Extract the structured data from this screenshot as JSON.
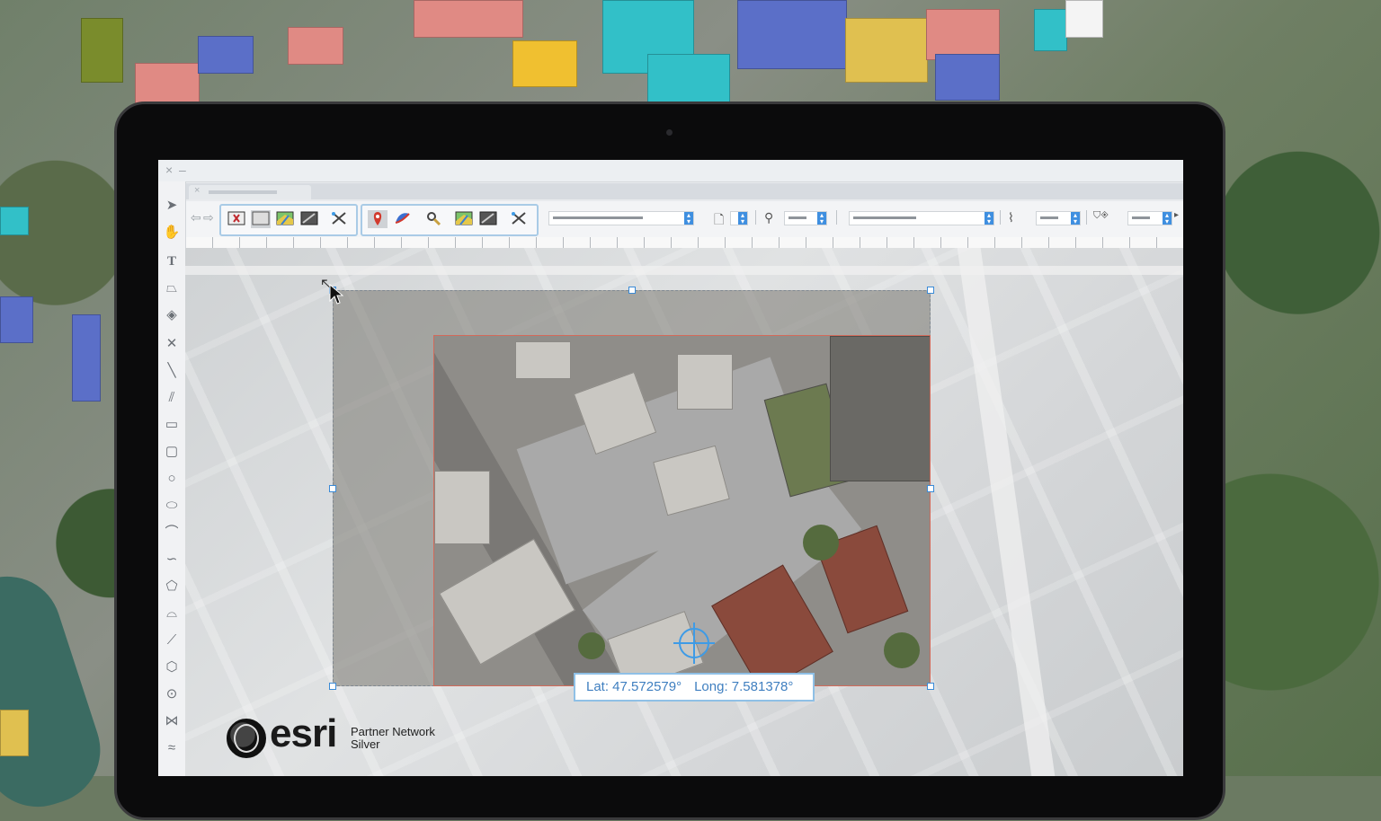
{
  "window": {
    "close_glyph": "×",
    "minimize_glyph": "–",
    "tab_close_glyph": "×"
  },
  "toolbar": {
    "nav_back": "⇦",
    "nav_forward": "⇨",
    "group1": [
      "delete-layer-icon",
      "blank-map-icon",
      "color-map-icon",
      "dark-map-icon",
      "tools-icon"
    ],
    "group2": [
      "map-pin-icon",
      "compass-icon",
      "zoom-tool-icon",
      "color-map-icon",
      "dark-map-icon",
      "tools-icon"
    ]
  },
  "left_tools": [
    "select-arrow-icon",
    "pan-hand-icon",
    "text-tool-icon",
    "shape-tool-icon",
    "layer-stack-icon",
    "delete-x-icon",
    "line-tool-icon",
    "double-line-icon",
    "rectangle-icon",
    "rounded-rectangle-icon",
    "circle-icon",
    "ellipse-icon",
    "arc-icon",
    "curve-icon",
    "polygon-icon",
    "freeform-icon",
    "polyline-icon",
    "hexagon-icon",
    "point-icon",
    "mirror-icon",
    "scribble-icon"
  ],
  "coordinates": {
    "lat_label": "Lat: 47.572579°",
    "long_label": "Long: 7.581378°"
  },
  "branding": {
    "logo_word": "esri",
    "line1": "Partner Network",
    "line2": "Silver"
  },
  "colors": {
    "accent_blue": "#3e9be6",
    "selection_red": "#d26a5a",
    "coord_text": "#3f7fc0"
  }
}
